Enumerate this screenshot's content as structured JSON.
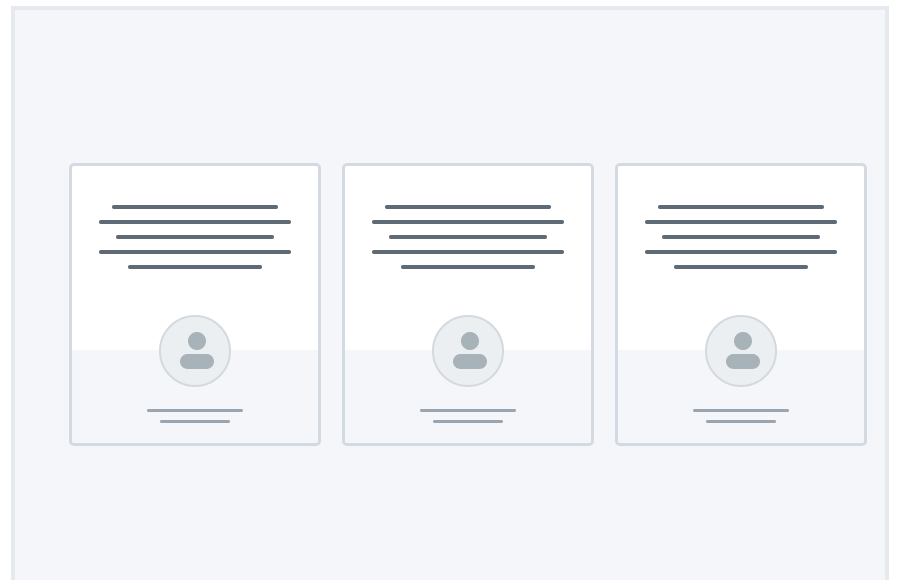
{
  "page": {
    "title": "",
    "cards": [
      {
        "avatar_icon": "user-icon"
      },
      {
        "avatar_icon": "user-icon"
      },
      {
        "avatar_icon": "user-icon"
      }
    ]
  },
  "colors": {
    "frame_background": "#f4f6fa",
    "frame_border": "#e6e9ee",
    "card_border": "#d3dae1",
    "card_background": "#ffffff",
    "card_footer_background": "#f4f6f9",
    "text_placeholder_dark": "#5e6b76",
    "text_placeholder_light": "#9aa5af",
    "avatar_background": "#eceff2",
    "avatar_icon": "#a7b2b9"
  }
}
